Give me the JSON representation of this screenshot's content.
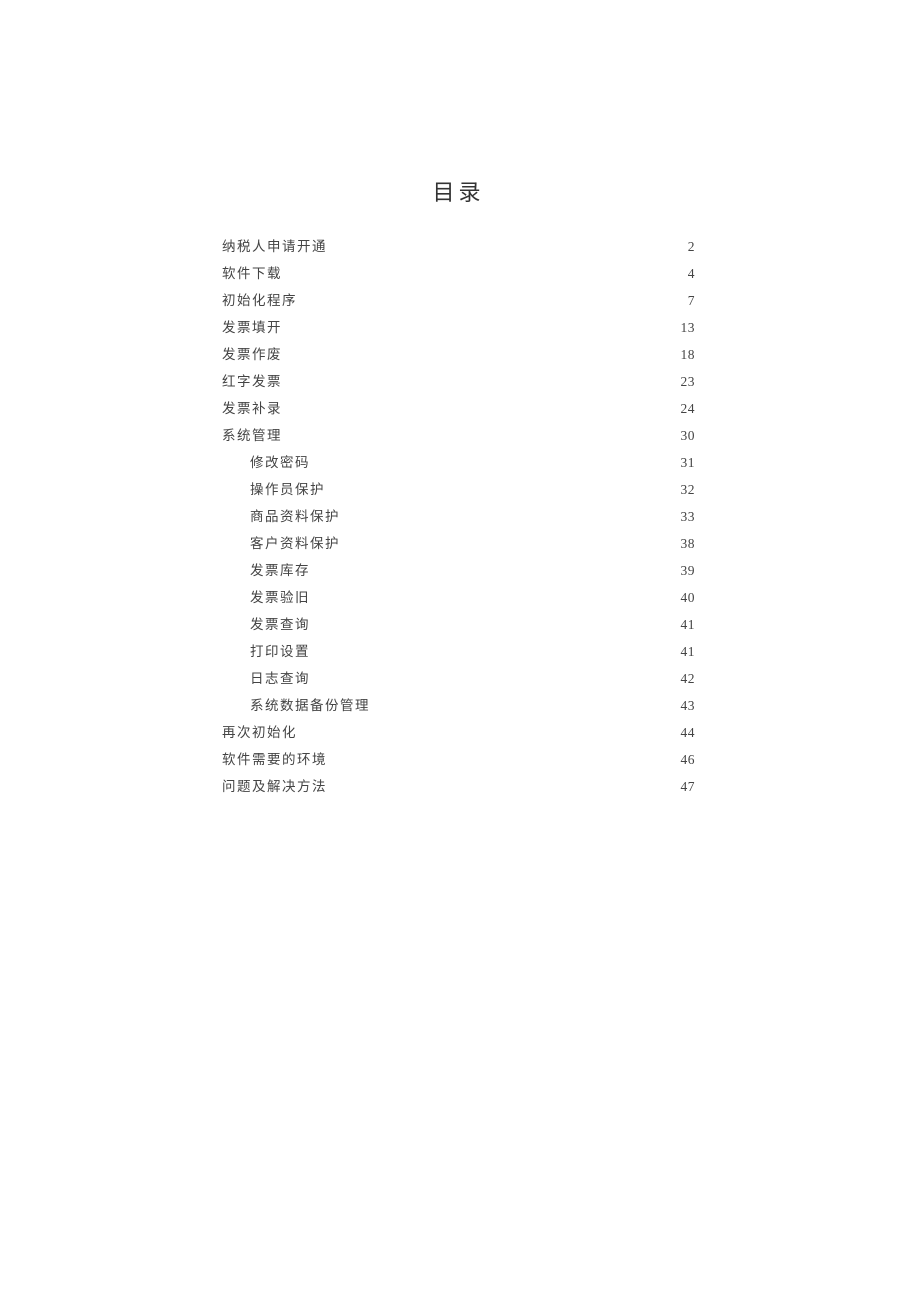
{
  "title": "目录",
  "toc": [
    {
      "label": "纳税人申请开通",
      "page": "2",
      "level": 1
    },
    {
      "label": "软件下载",
      "page": "4",
      "level": 1
    },
    {
      "label": "初始化程序",
      "page": "7",
      "level": 1
    },
    {
      "label": "发票填开",
      "page": "13",
      "level": 1
    },
    {
      "label": "发票作废",
      "page": "18",
      "level": 1
    },
    {
      "label": "红字发票",
      "page": "23",
      "level": 1
    },
    {
      "label": "发票补录",
      "page": "24",
      "level": 1
    },
    {
      "label": "系统管理",
      "page": "30",
      "level": 1
    },
    {
      "label": "修改密码",
      "page": "31",
      "level": 2
    },
    {
      "label": "操作员保护",
      "page": "32",
      "level": 2
    },
    {
      "label": "商品资料保护",
      "page": "33",
      "level": 2
    },
    {
      "label": "客户资料保护",
      "page": "38",
      "level": 2
    },
    {
      "label": "发票库存",
      "page": "39",
      "level": 2
    },
    {
      "label": "发票验旧",
      "page": "40",
      "level": 2
    },
    {
      "label": "发票查询",
      "page": "41",
      "level": 2
    },
    {
      "label": "打印设置",
      "page": "41",
      "level": 2
    },
    {
      "label": "日志查询",
      "page": "42",
      "level": 2
    },
    {
      "label": "系统数据备份管理",
      "page": "43",
      "level": 2
    },
    {
      "label": "再次初始化",
      "page": "44",
      "level": 1
    },
    {
      "label": "软件需要的环境",
      "page": "46",
      "level": 1
    },
    {
      "label": "问题及解决方法",
      "page": "47",
      "level": 1
    }
  ]
}
